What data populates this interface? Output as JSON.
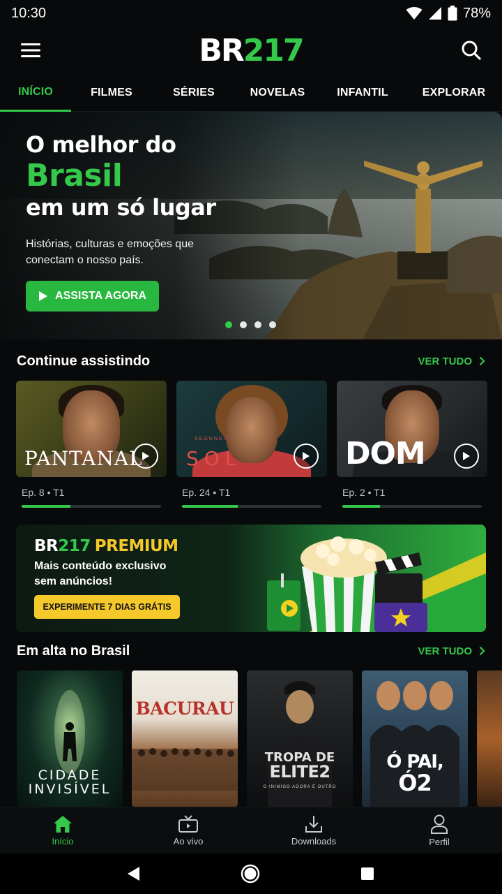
{
  "status": {
    "time": "10:30",
    "battery": "78%"
  },
  "header": {
    "logo_a": "BR",
    "logo_b": "217"
  },
  "tabs": [
    {
      "label": "INÍCIO",
      "active": true
    },
    {
      "label": "FILMES"
    },
    {
      "label": "SÉRIES"
    },
    {
      "label": "NOVELAS"
    },
    {
      "label": "INFANTIL"
    },
    {
      "label": "EXPLORAR"
    }
  ],
  "hero": {
    "line1": "O melhor do",
    "line2": "Brasil",
    "line3": "em um só lugar",
    "subtitle": "Histórias, culturas e emoções que conectam o nosso país.",
    "cta": "ASSISTA AGORA",
    "carousel_pages": 4,
    "carousel_active": 1
  },
  "continue": {
    "title": "Continue assistindo",
    "see_all": "VER TUDO",
    "items": [
      {
        "title": "PANTANAL",
        "meta": "Ep. 8 • T1",
        "progress": 0.35
      },
      {
        "title": "SOL",
        "tagline": "SEGUNDO",
        "meta": "Ep. 24 • T1",
        "progress": 0.4
      },
      {
        "title": "DOM",
        "meta": "Ep. 2 • T1",
        "progress": 0.27
      }
    ]
  },
  "premium": {
    "logo_a": "BR",
    "logo_b": "217",
    "logo_word": "PREMIUM",
    "description": "Mais conteúdo exclusivo sem anúncios!",
    "cta": "EXPERIMENTE 7 DIAS GRÁTIS"
  },
  "trending": {
    "title": "Em alta no Brasil",
    "see_all": "VER TUDO",
    "items": [
      {
        "title_a": "CIDADE",
        "title_b": "INVISÍVEL"
      },
      {
        "title": "BACURAU"
      },
      {
        "title_a": "TROPA DE",
        "title_b": "ELITE",
        "number": "2",
        "tagline": "O INIMIGO AGORA É OUTRO"
      },
      {
        "title_a": "Ó PAI,",
        "title_b": "Ó2"
      },
      {
        "title": ""
      }
    ]
  },
  "bottom_nav": [
    {
      "label": "Início",
      "icon": "home-icon",
      "active": true
    },
    {
      "label": "Ao vivo",
      "icon": "tv-icon"
    },
    {
      "label": "Downloads",
      "icon": "download-icon"
    },
    {
      "label": "Perfil",
      "icon": "person-icon"
    }
  ],
  "colors": {
    "accent": "#34c94a",
    "background": "#07090a",
    "premium_yellow": "#f6c92b"
  }
}
